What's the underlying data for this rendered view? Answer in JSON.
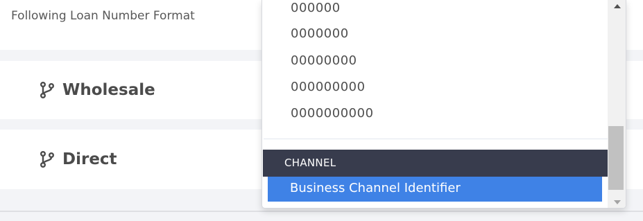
{
  "background": {
    "format_label": "Following Loan Number Format",
    "channels": [
      {
        "name": "Wholesale",
        "icon": "branch-icon"
      },
      {
        "name": "Direct",
        "icon": "branch-icon"
      }
    ]
  },
  "dropdown": {
    "options": [
      "000000",
      "0000000",
      "00000000",
      "000000000",
      "0000000000"
    ],
    "group_header": "CHANNEL",
    "highlighted_option": "Business Channel Identifier"
  },
  "colors": {
    "group_header_bg": "#383c4d",
    "highlight_bg": "#3f82e6",
    "page_bg": "#f3f4f7"
  }
}
